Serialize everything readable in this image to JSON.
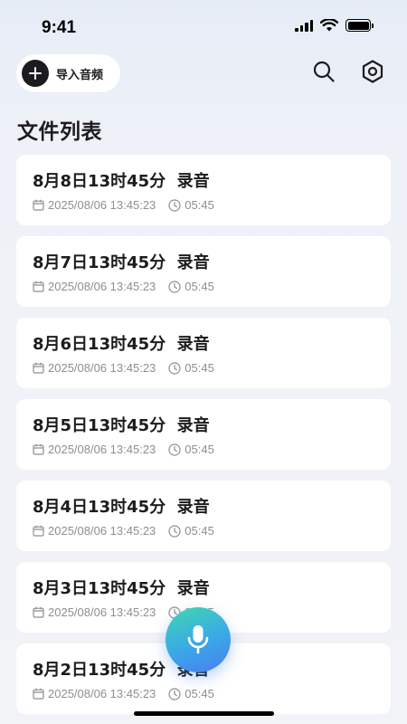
{
  "status_bar": {
    "time": "9:41"
  },
  "header": {
    "import_label": "导入音频",
    "icons": {
      "search": "search-icon",
      "settings": "settings-icon"
    }
  },
  "section_title": "文件列表",
  "files": [
    {
      "title": "8月8日13时45分  录音",
      "date": "2025/08/06 13:45:23",
      "duration": "05:45"
    },
    {
      "title": "8月7日13时45分  录音",
      "date": "2025/08/06 13:45:23",
      "duration": "05:45"
    },
    {
      "title": "8月6日13时45分  录音",
      "date": "2025/08/06 13:45:23",
      "duration": "05:45"
    },
    {
      "title": "8月5日13时45分  录音",
      "date": "2025/08/06 13:45:23",
      "duration": "05:45"
    },
    {
      "title": "8月4日13时45分  录音",
      "date": "2025/08/06 13:45:23",
      "duration": "05:45"
    },
    {
      "title": "8月3日13时45分  录音",
      "date": "2025/08/06 13:45:23",
      "duration": "05:45"
    },
    {
      "title": "8月2日13时45分  录音",
      "date": "2025/08/06 13:45:23",
      "duration": "05:45"
    }
  ],
  "colors": {
    "accent_gradient_start": "#3fd8b0",
    "accent_gradient_end": "#4a7cf0",
    "text_primary": "#1c1c1e",
    "text_secondary": "#8e8e93"
  }
}
